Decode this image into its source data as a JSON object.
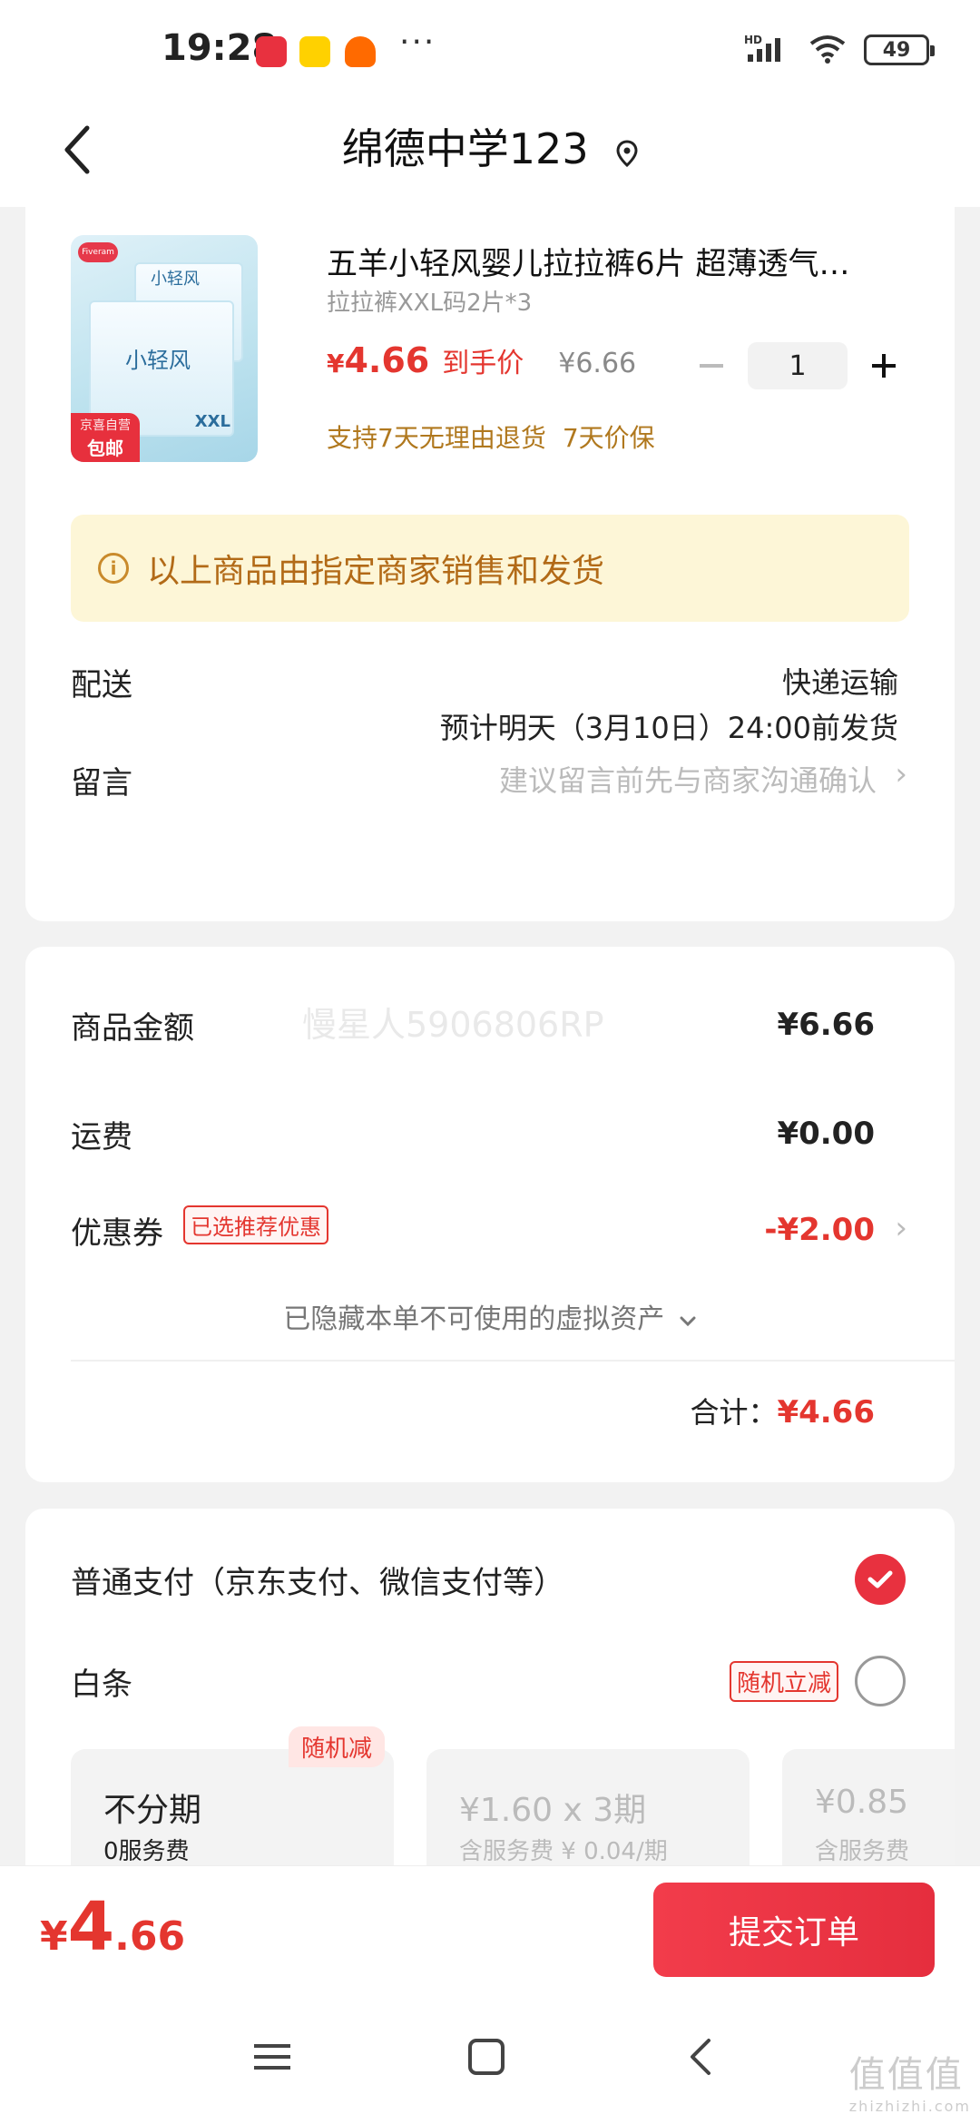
{
  "status_bar": {
    "time": "19:28",
    "battery": "49",
    "app_colors": [
      "#e8313f",
      "#ffd100",
      "#ff6a00"
    ],
    "signal_label": "HD"
  },
  "nav": {
    "title": "绵德中学123"
  },
  "product": {
    "title": "五羊小轻风婴儿拉拉裤6片 超薄透气…",
    "spec": "拉拉裤XXL码2片*3",
    "price_symbol": "¥",
    "price": "4.66",
    "price_label": "到手价",
    "original_price": "¥6.66",
    "quantity": "1",
    "image_tag_line1": "京喜自营",
    "image_tag_line2": "包邮",
    "image_brand": "Fiveram",
    "image_brand_text": "小轻风",
    "image_size": "XXL",
    "services": [
      "支持7天无理由退货",
      "7天价保"
    ]
  },
  "notice": {
    "text": "以上商品由指定商家销售和发货"
  },
  "delivery": {
    "label": "配送",
    "method": "快递运输",
    "eta": "预计明天（3月10日）24:00前发货"
  },
  "message": {
    "label": "留言",
    "placeholder": "建议留言前先与商家沟通确认"
  },
  "amounts": {
    "watermark": "慢星人5906806RP",
    "goods_label": "商品金额",
    "goods_value": "¥6.66",
    "shipping_label": "运费",
    "shipping_value": "¥0.00",
    "coupon_label": "优惠券",
    "coupon_badge": "已选推荐优惠",
    "coupon_value": "-¥2.00",
    "hidden_assets": "已隐藏本单不可使用的虚拟资产",
    "total_label": "合计：",
    "total_value": "¥4.66"
  },
  "payment": {
    "normal_label": "普通支付（京东支付、微信支付等）",
    "baitiao_label": "白条",
    "random_badge": "随机立减",
    "plan_tag": "随机减",
    "plans": [
      {
        "main": "不分期",
        "sub": "0服务费"
      },
      {
        "main": "¥1.60 x 3期",
        "sub": "含服务费 ¥ 0.04/期"
      },
      {
        "main": "¥0.85",
        "sub": "含服务费"
      }
    ]
  },
  "bottom": {
    "price_symbol": "¥",
    "price_int": "4",
    "price_dec": ".66",
    "submit_label": "提交订单"
  },
  "corner_watermark": {
    "text": "值值值",
    "sub": "zhizhizhi.com"
  },
  "colors": {
    "accent_red": "#e4362f",
    "notice_bg": "#fdf6d7",
    "notice_text": "#b26a17",
    "service_text": "#b0781e"
  }
}
